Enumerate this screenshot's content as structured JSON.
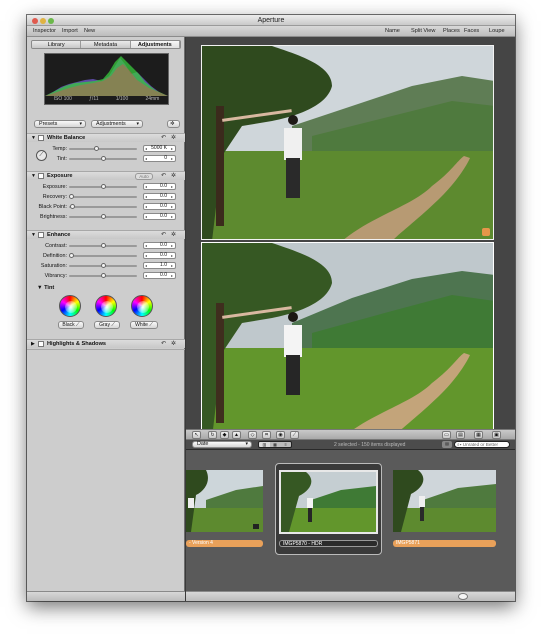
{
  "window": {
    "title": "Aperture"
  },
  "toolbar": {
    "left": [
      "Inspector",
      "Import",
      "New"
    ],
    "right": [
      "Name",
      "Split View",
      "Places",
      "Faces",
      "Loupe"
    ]
  },
  "inspector": {
    "tabs": [
      "Library",
      "Metadata",
      "Adjustments"
    ],
    "active_tab": "Adjustments",
    "histogram_meta": [
      "ISO 100",
      "ƒ/11",
      "1/100",
      "24mm"
    ],
    "presets_label": "Presets",
    "adjustments_label": "Adjustments",
    "white_balance": {
      "title": "White Balance",
      "rows": [
        {
          "label": "Temp:",
          "value": "5000 K",
          "level": 0.4
        },
        {
          "label": "Tint:",
          "value": "0",
          "level": 0.5
        }
      ]
    },
    "exposure": {
      "title": "Exposure",
      "auto_label": "Auto",
      "rows": [
        {
          "label": "Exposure:",
          "value": "0.0",
          "level": 0.5
        },
        {
          "label": "Recovery:",
          "value": "0.0",
          "level": 0.0
        },
        {
          "label": "Black Point:",
          "value": "0.0",
          "level": 0.02
        },
        {
          "label": "Brightness:",
          "value": "0.0",
          "level": 0.5
        }
      ]
    },
    "enhance": {
      "title": "Enhance",
      "rows": [
        {
          "label": "Contrast:",
          "value": "0.0",
          "level": 0.5
        },
        {
          "label": "Definition:",
          "value": "0.0",
          "level": 0.0
        },
        {
          "label": "Saturation:",
          "value": "1.0",
          "level": 0.5
        },
        {
          "label": "Vibrancy:",
          "value": "0.0",
          "level": 0.5
        }
      ],
      "tint_label": "Tint",
      "wheels": [
        "Black",
        "Gray",
        "White"
      ]
    },
    "highlights": {
      "title": "Highlights & Shadows"
    }
  },
  "browser": {
    "sort_by": "Date",
    "status": "2 selected - 150 items displayed",
    "search_placeholder": "Unrated or Better"
  },
  "filmstrip": [
    {
      "caption": "- Version 4",
      "selected": false
    },
    {
      "caption": "IMGP5870 - HDR",
      "selected": true
    },
    {
      "caption": "IMGP5871",
      "selected": false
    }
  ],
  "colors": {
    "accent": "#e6964a",
    "caption_orange": "#e9a15a",
    "selection_border": "#e8e8e8"
  },
  "icons": [
    "close-icon",
    "minimize-icon",
    "zoom-icon",
    "gear-icon",
    "reset-icon",
    "eyedropper-icon",
    "pointer-icon",
    "rotate-icon",
    "crop-icon",
    "straighten-icon",
    "red-eye-icon",
    "brush-icon",
    "search-icon",
    "badge-icon"
  ]
}
